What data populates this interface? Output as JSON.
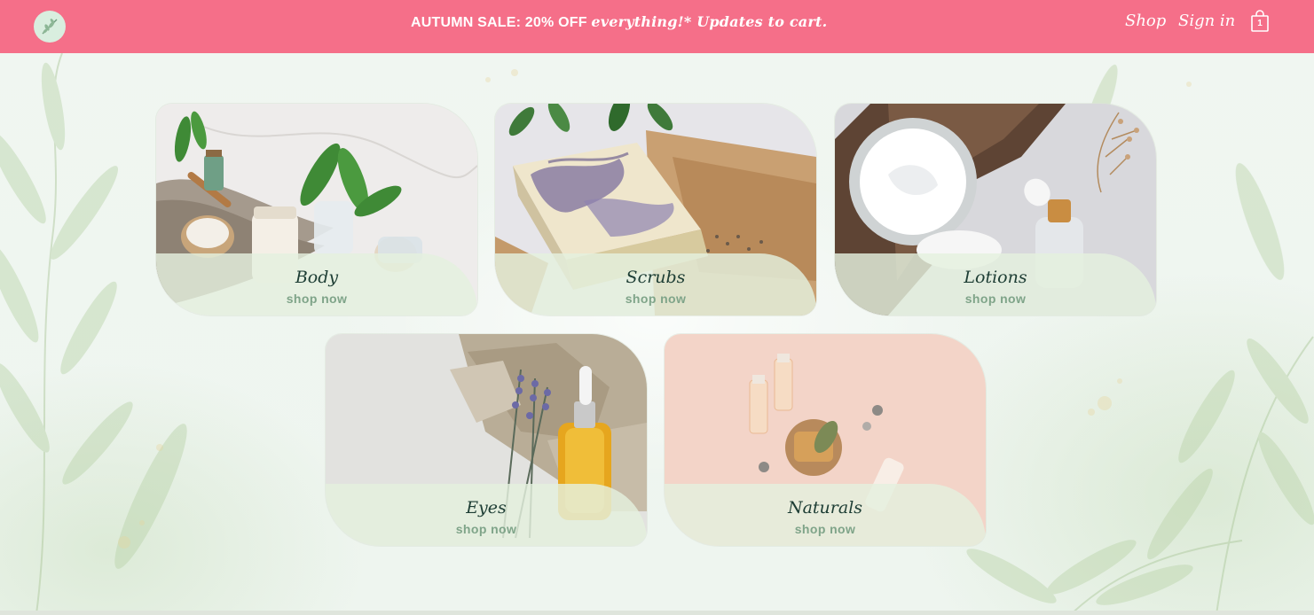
{
  "header": {
    "logo_icon": "leaf-sprig-icon",
    "sale_prefix": "AUTUMN SALE: 20% OFF ",
    "sale_emphasis": "everything!* Updates to cart.",
    "nav": {
      "shop": "Shop",
      "sign_in": "Sign in"
    },
    "cart": {
      "icon": "shopping-bag-icon",
      "count": "1"
    }
  },
  "colors": {
    "header_bg": "#f56f89",
    "card_title": "#1d3d34",
    "card_cta": "#7fa489",
    "page_bg": "#f2f7f3"
  },
  "categories": [
    {
      "title": "Body",
      "cta": "shop now",
      "image": "spa-jars-towel-photo"
    },
    {
      "title": "Scrubs",
      "cta": "shop now",
      "image": "marbled-soap-bar-photo"
    },
    {
      "title": "Lotions",
      "cta": "shop now",
      "image": "cream-jar-dropper-photo"
    },
    {
      "title": "Eyes",
      "cta": "shop now",
      "image": "serum-bottle-lavender-photo"
    },
    {
      "title": "Naturals",
      "cta": "shop now",
      "image": "natural-soap-vials-photo"
    }
  ]
}
